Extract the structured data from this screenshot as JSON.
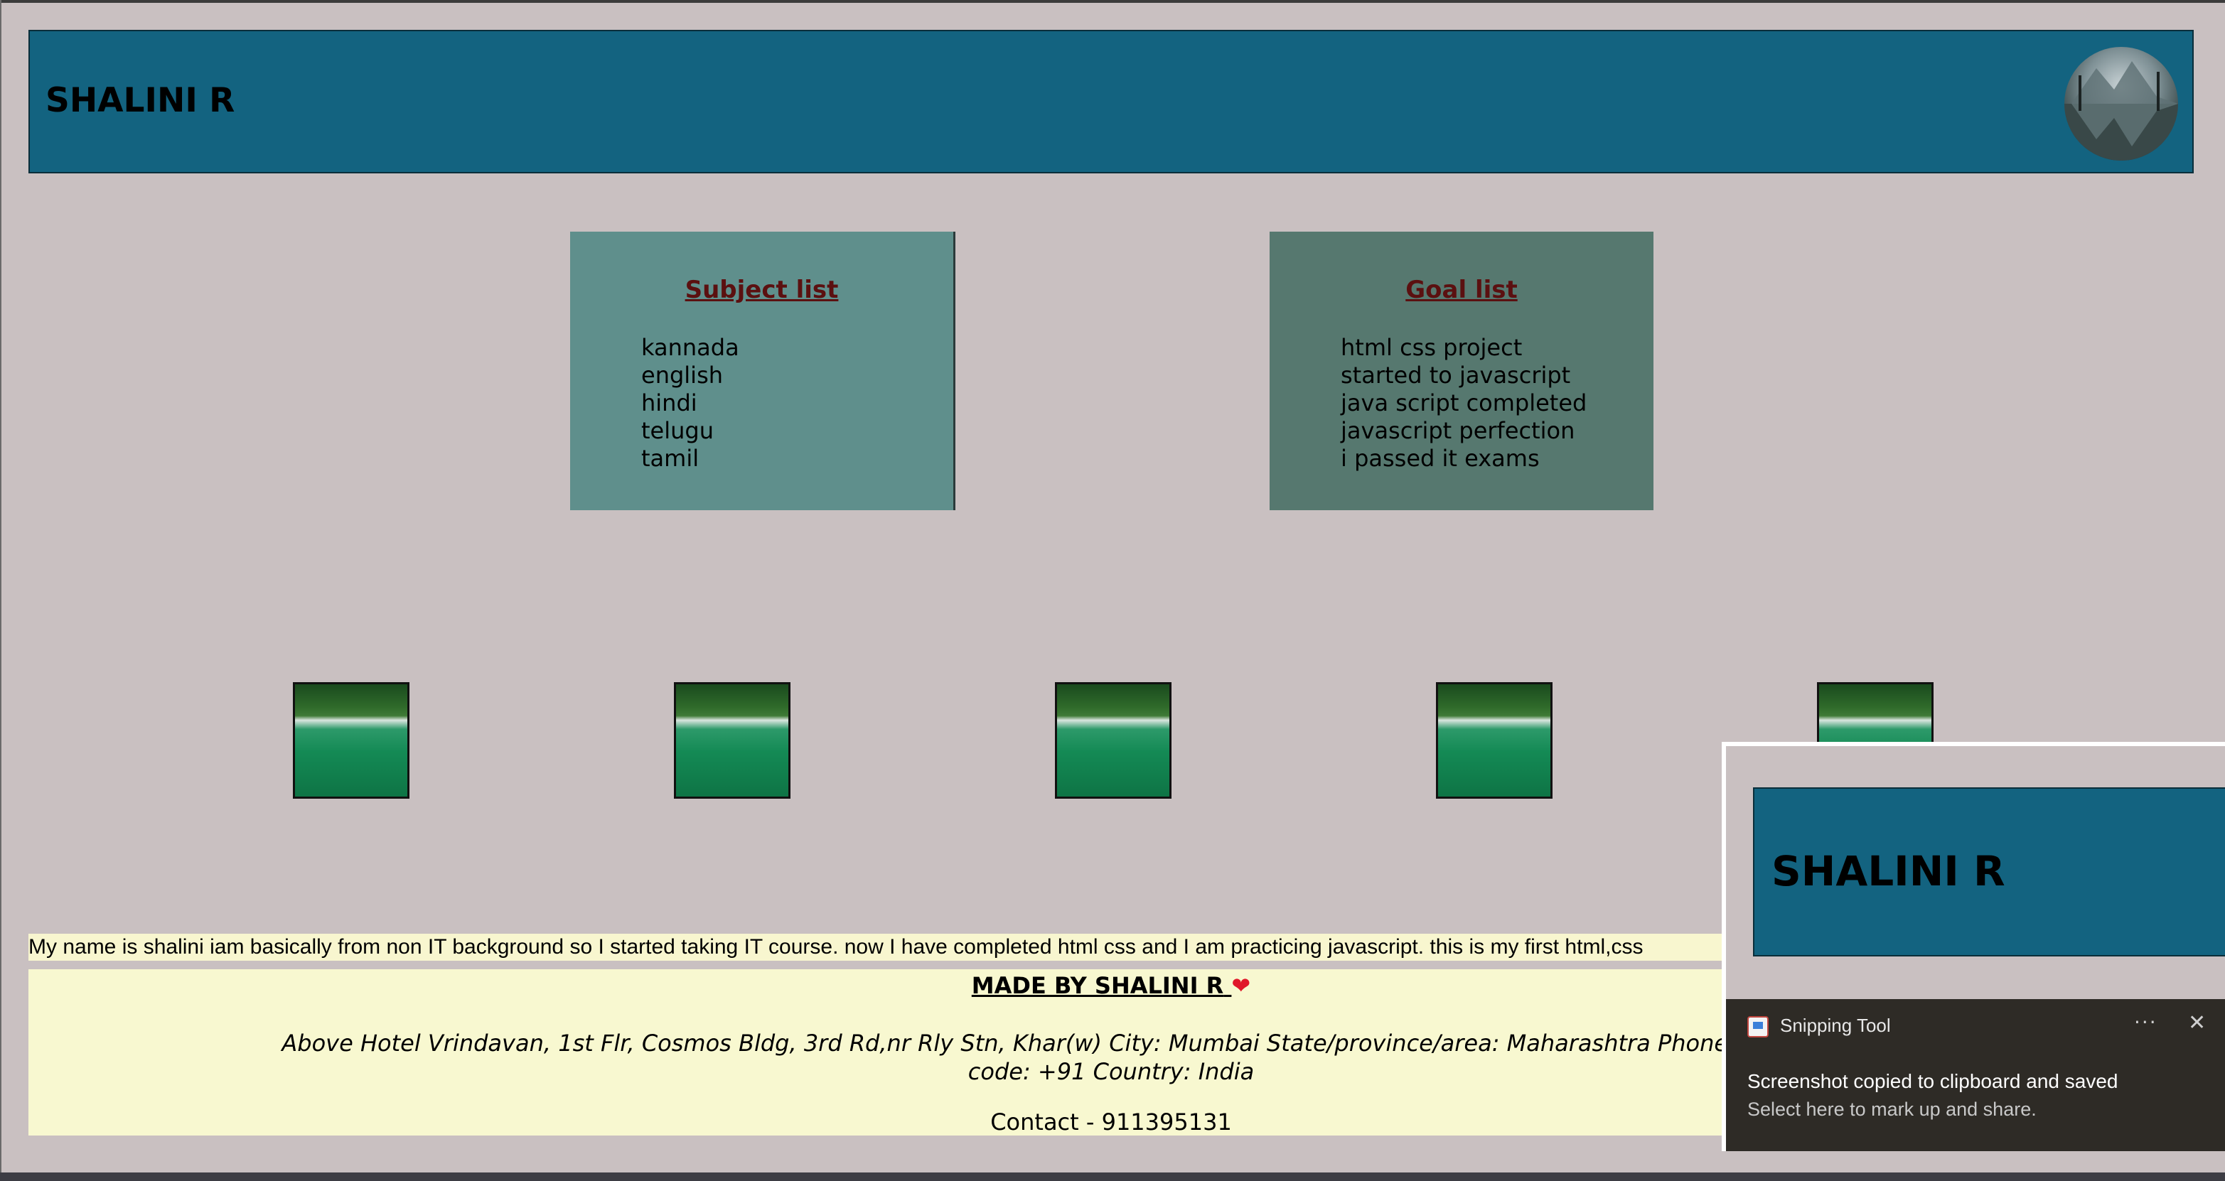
{
  "header": {
    "title": "SHALINI R"
  },
  "subjects": {
    "title": "Subject list",
    "items": [
      "kannada",
      "english",
      "hindi",
      "telugu",
      "tamil"
    ]
  },
  "goals": {
    "title": "Goal list",
    "items": [
      "html css project",
      "started to javascript",
      "java script completed",
      "javascript perfection",
      "i passed it exams"
    ]
  },
  "bio": "My name is shalini iam basically from non IT background so I started taking IT course. now I have completed html css and I am practicing javascript. this is my first html,css",
  "footer": {
    "title": "MADE BY SHALINI R",
    "heart": "❤",
    "address_line1": "Above Hotel Vrindavan, 1st Flr, Cosmos Bldg, 3rd Rd,nr Rly Stn, Khar(w) City: Mumbai State/province/area: Maharashtra Phone number: 0222649",
    "address_line2": "code: +91 Country: India",
    "contact": "Contact - 911395131"
  },
  "snipping_tool": {
    "preview_title": "SHALINI R",
    "app_name": "Snipping Tool",
    "more_icon": "···",
    "close_icon": "✕",
    "heading": "Screenshot copied to clipboard and saved",
    "body": "Select here to mark up and share."
  }
}
